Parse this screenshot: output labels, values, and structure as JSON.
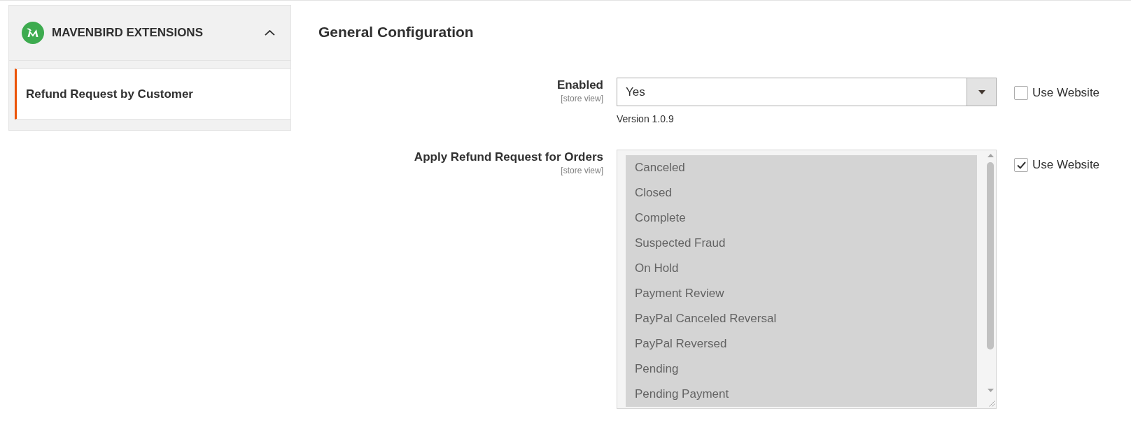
{
  "sidebar": {
    "sections": [
      {
        "title": "MAVENBIRD EXTENSIONS",
        "expanded": true,
        "items": [
          {
            "label": "Refund Request by Customer",
            "selected": true
          }
        ]
      }
    ]
  },
  "main": {
    "title": "General Configuration",
    "fields": [
      {
        "kind": "select",
        "label": "Enabled",
        "scope": "[store view]",
        "value": "Yes",
        "note": "Version 1.0.9",
        "disabled": false,
        "use_website": {
          "label": "Use Website",
          "checked": false
        }
      },
      {
        "kind": "multiselect",
        "label": "Apply Refund Request for Orders",
        "scope": "[store view]",
        "disabled": true,
        "options": [
          {
            "label": "Canceled",
            "selected": true
          },
          {
            "label": "Closed",
            "selected": true
          },
          {
            "label": "Complete",
            "selected": true
          },
          {
            "label": "Suspected Fraud",
            "selected": true
          },
          {
            "label": "On Hold",
            "selected": true
          },
          {
            "label": "Payment Review",
            "selected": true
          },
          {
            "label": "PayPal Canceled Reversal",
            "selected": true
          },
          {
            "label": "PayPal Reversed",
            "selected": true
          },
          {
            "label": "Pending",
            "selected": true
          },
          {
            "label": "Pending Payment",
            "selected": true
          }
        ],
        "use_website": {
          "label": "Use Website",
          "checked": true
        }
      }
    ]
  }
}
